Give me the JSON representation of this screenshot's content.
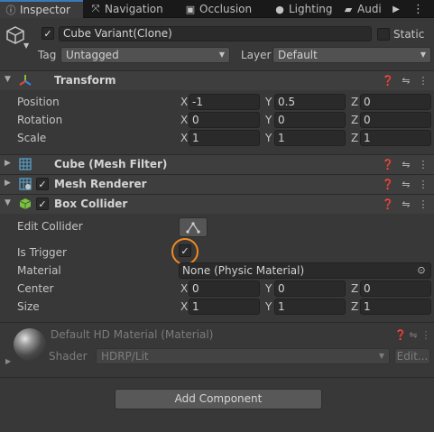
{
  "tabs": [
    {
      "label": "Inspector",
      "icon": "info-icon",
      "active": true
    },
    {
      "label": "Navigation",
      "icon": "navigation-icon",
      "active": false
    },
    {
      "label": "Occlusion",
      "icon": "occlusion-icon",
      "active": false
    },
    {
      "label": "Lighting",
      "icon": "lighting-icon",
      "active": false
    },
    {
      "label": "Audi",
      "icon": "audio-icon",
      "active": false
    }
  ],
  "object": {
    "active": true,
    "name": "Cube Variant(Clone)",
    "static_label": "Static",
    "static": false,
    "tag_label": "Tag",
    "tag_value": "Untagged",
    "layer_label": "Layer",
    "layer_value": "Default"
  },
  "transform": {
    "title": "Transform",
    "position_label": "Position",
    "rotation_label": "Rotation",
    "scale_label": "Scale",
    "position": {
      "x": "-1",
      "y": "0.5",
      "z": "0"
    },
    "rotation": {
      "x": "0",
      "y": "0",
      "z": "0"
    },
    "scale": {
      "x": "1",
      "y": "1",
      "z": "1"
    }
  },
  "axes": {
    "x": "X",
    "y": "Y",
    "z": "Z"
  },
  "mesh_filter": {
    "title": "Cube (Mesh Filter)"
  },
  "mesh_renderer": {
    "title": "Mesh Renderer",
    "enabled": true
  },
  "box_collider": {
    "title": "Box Collider",
    "enabled": true,
    "edit_collider_label": "Edit Collider",
    "is_trigger_label": "Is Trigger",
    "is_trigger": true,
    "material_label": "Material",
    "material_value": "None (Physic Material)",
    "center_label": "Center",
    "size_label": "Size",
    "center": {
      "x": "0",
      "y": "0",
      "z": "0"
    },
    "size": {
      "x": "1",
      "y": "1",
      "z": "1"
    }
  },
  "material": {
    "title": "Default HD Material (Material)",
    "shader_label": "Shader",
    "shader_value": "HDRP/Lit",
    "edit_label": "Edit..."
  },
  "add_component_label": "Add Component",
  "colors": {
    "highlight_ring": "#f08a24",
    "tab_accent": "#3a79bb",
    "panel_bg": "#383838"
  }
}
